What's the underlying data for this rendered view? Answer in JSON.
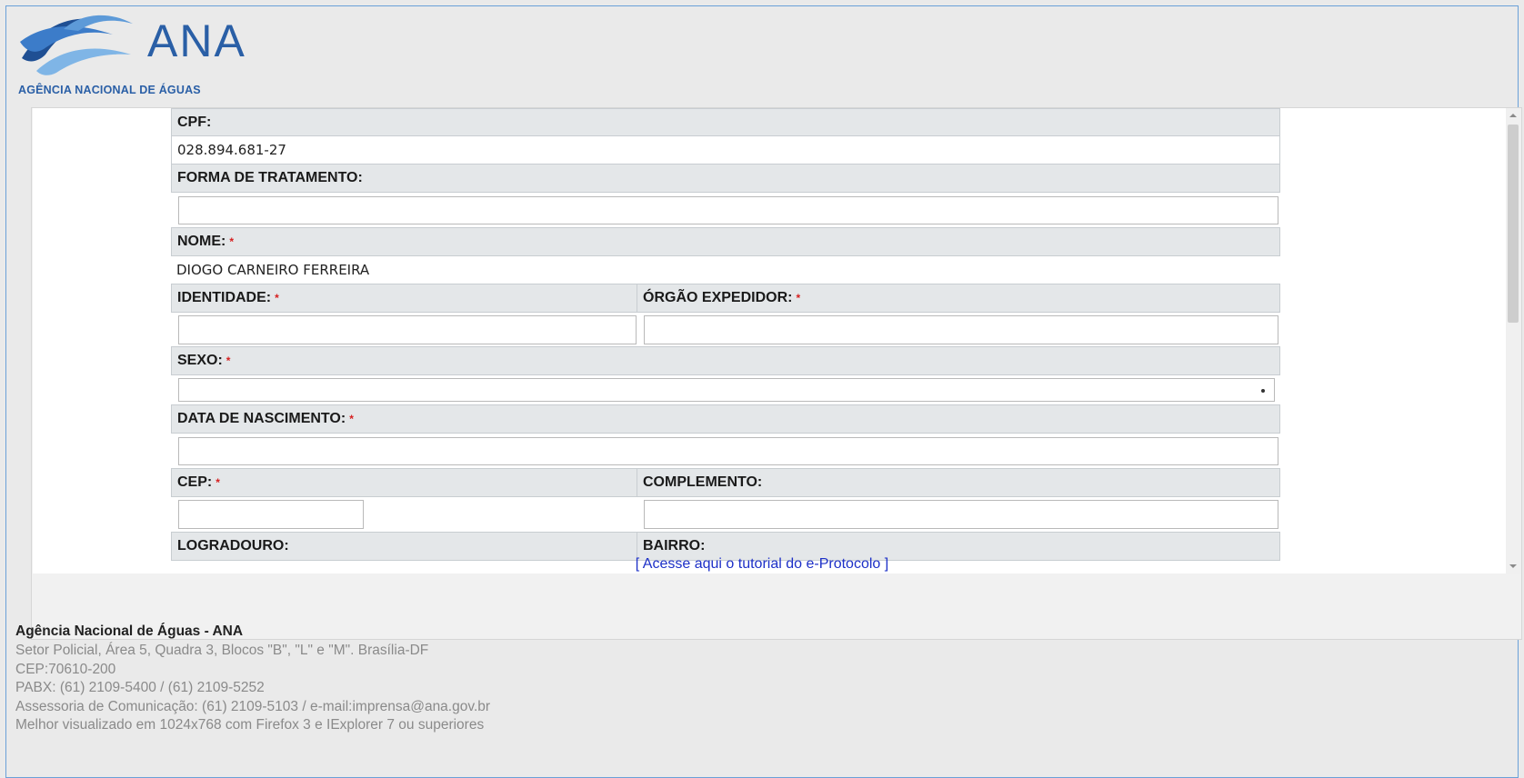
{
  "logo": {
    "name": "ANA",
    "subtitle": "AGÊNCIA NACIONAL DE ÁGUAS",
    "colors": {
      "dark": "#1f4f93",
      "mid": "#3c7cc9",
      "light": "#7fb5e6"
    }
  },
  "form": {
    "cpf_label": "CPF:",
    "cpf_value": "028.894.681-27",
    "forma_tratamento_label": "FORMA DE TRATAMENTO:",
    "forma_tratamento_value": "",
    "nome_label": "NOME:",
    "nome_value": "DIOGO CARNEIRO FERREIRA",
    "identidade_label": "IDENTIDADE:",
    "identidade_value": "",
    "orgao_label": "ÓRGÃO EXPEDIDOR:",
    "orgao_value": "",
    "sexo_label": "SEXO:",
    "sexo_value": "",
    "nascimento_label": "DATA DE NASCIMENTO:",
    "nascimento_value": "",
    "cep_label": "CEP:",
    "cep_value": "",
    "complemento_label": "COMPLEMENTO:",
    "complemento_value": "",
    "logradouro_label": "LOGRADOURO:",
    "bairro_label": "BAIRRO:",
    "required_mark": "*"
  },
  "tutorial_link": "[ Acesse aqui o tutorial do e-Protocolo ]",
  "footer": {
    "org": "Agência Nacional de Águas - ANA",
    "address": "Setor Policial, Área 5, Quadra 3, Blocos \"B\", \"L\" e \"M\". Brasília-DF",
    "cep": "CEP:70610-200",
    "pabx": "PABX: (61) 2109-5400 / (61) 2109-5252",
    "comunicacao": "Assessoria de Comunicação: (61) 2109-5103 / e-mail:imprensa@ana.gov.br",
    "browser_note": "Melhor visualizado em 1024x768 com Firefox 3 e IExplorer 7 ou superiores"
  },
  "accent_colors": {
    "required": "#d62020",
    "link": "#1d30c7",
    "header_bg": "#e4e7e9"
  }
}
